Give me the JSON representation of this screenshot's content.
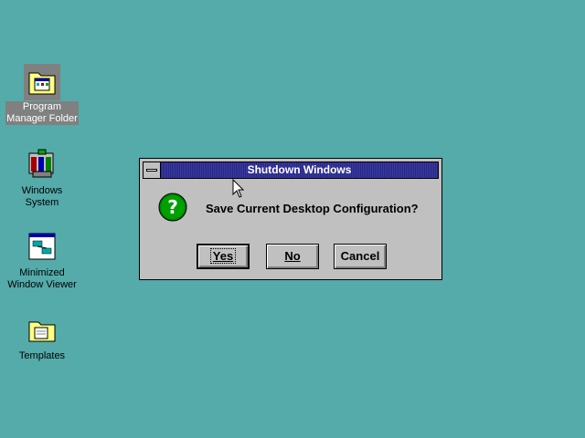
{
  "desktop": {
    "background_color": "#55aaaa",
    "icons": [
      {
        "label": "Program\nManager Folder",
        "icon": "program-manager-folder-icon",
        "selected": true
      },
      {
        "label": "Windows\nSystem",
        "icon": "windows-system-icon",
        "selected": false
      },
      {
        "label": "Minimized\nWindow Viewer",
        "icon": "minimized-window-viewer-icon",
        "selected": false
      },
      {
        "label": "Templates",
        "icon": "templates-folder-icon",
        "selected": false
      }
    ]
  },
  "dialog": {
    "title": "Shutdown Windows",
    "message": "Save Current Desktop Configuration?",
    "icon": "question-icon",
    "buttons": {
      "yes": "Yes",
      "no": "No",
      "cancel": "Cancel"
    },
    "title_color": "#2a2a8f",
    "face_color": "#c0c0c0"
  }
}
